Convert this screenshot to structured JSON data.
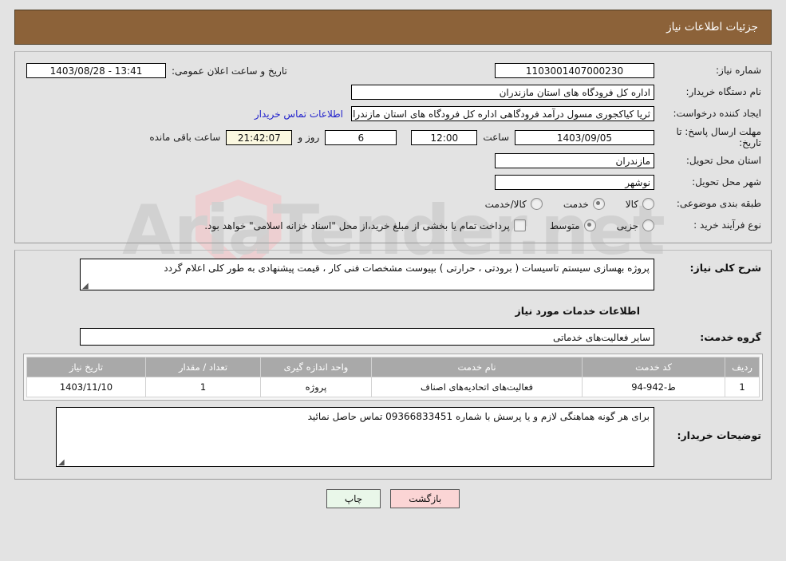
{
  "header": {
    "title": "جزئیات اطلاعات نیاز"
  },
  "watermark": {
    "text": "AriaTender.net",
    "shield_icon": "shield-icon"
  },
  "form": {
    "need_number": {
      "label": "شماره نیاز:",
      "value": "1103001407000230"
    },
    "public_announce": {
      "label": "تاریخ و ساعت اعلان عمومی:",
      "value": "13:41 - 1403/08/28"
    },
    "buyer_org": {
      "label": "نام دستگاه خریدار:",
      "value": "اداره کل فرودگاه های استان مازندران"
    },
    "requester": {
      "label": "ایجاد کننده درخواست:",
      "value": "ثریا کیاکجوری مسول درآمد فرودگاهی اداره کل فرودگاه های استان مازندران",
      "contact_link": "اطلاعات تماس خریدار"
    },
    "deadline": {
      "label": "مهلت ارسال پاسخ: تا تاریخ:",
      "date": "1403/09/05",
      "hour_label": "ساعت",
      "hour": "12:00",
      "days": "6",
      "days_label": "روز و",
      "countdown": "21:42:07",
      "countdown_label": "ساعت باقی مانده"
    },
    "delivery_province": {
      "label": "استان محل تحویل:",
      "value": "مازندران"
    },
    "delivery_city": {
      "label": "شهر محل تحویل:",
      "value": "نوشهر"
    },
    "classification": {
      "label": "طبقه بندی موضوعی:",
      "options": [
        {
          "label": "کالا",
          "checked": false
        },
        {
          "label": "خدمت",
          "checked": true
        },
        {
          "label": "کالا/خدمت",
          "checked": false
        }
      ]
    },
    "purchase_type": {
      "label": "نوع فرآیند خرید :",
      "options": [
        {
          "label": "جزیی",
          "checked": false
        },
        {
          "label": "متوسط",
          "checked": true
        }
      ],
      "checkbox_label": "پرداخت تمام یا بخشی از مبلغ خرید،از محل \"اسناد خزانه اسلامی\" خواهد بود.",
      "checkbox_checked": false
    }
  },
  "main": {
    "general_desc": {
      "label": "شرح کلی نیاز:",
      "value": "پروژه بهسازی سیستم تاسیسات ( برودتی ، حرارتی ) بپیوست مشخصات فنی کار ، قیمت پیشنهادی به طور کلی اعلام گردد"
    },
    "services_section_title": "اطلاعات خدمات مورد نیاز",
    "service_group": {
      "label": "گروه خدمت:",
      "value": "سایر فعالیت‌های خدماتی"
    },
    "table": {
      "columns": [
        "ردیف",
        "کد خدمت",
        "نام خدمت",
        "واحد اندازه گیری",
        "تعداد / مقدار",
        "تاریخ نیاز"
      ],
      "rows": [
        {
          "index": "1",
          "code": "ط-942-94",
          "name": "فعالیت‌های اتحادیه‌های اصناف",
          "unit": "پروژه",
          "quantity": "1",
          "need_date": "1403/11/10"
        }
      ]
    },
    "buyer_notes": {
      "label": "توضیحات خریدار:",
      "value": "برای هر گونه هماهنگی لازم و یا  پرسش با شماره 09366833451 تماس حاصل نمائید"
    }
  },
  "footer": {
    "print_label": "چاپ",
    "back_label": "بازگشت"
  },
  "colors": {
    "header_bg": "#8c6239",
    "back_button_bg": "#fbd5d5",
    "print_button_bg": "#e9f7e9",
    "link": "#2222cc",
    "highlight_field": "#fbf8e0",
    "table_header_bg": "#a9a9a9"
  }
}
